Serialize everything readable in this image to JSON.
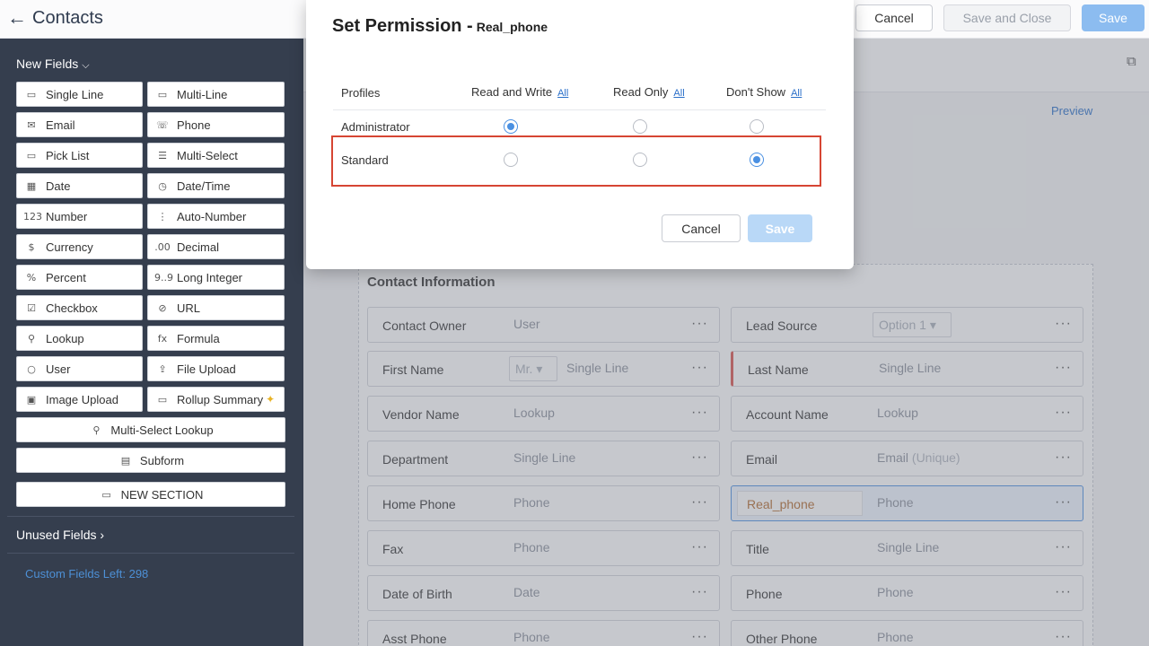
{
  "header": {
    "title": "Contacts",
    "cancel_label": "Cancel",
    "save_close_label": "Save and Close",
    "save_label": "Save"
  },
  "sidebar": {
    "new_fields_label": "New Fields",
    "fields": [
      {
        "label": "Single Line",
        "icon": "▭"
      },
      {
        "label": "Multi-Line",
        "icon": "▭"
      },
      {
        "label": "Email",
        "icon": "✉"
      },
      {
        "label": "Phone",
        "icon": "☏"
      },
      {
        "label": "Pick List",
        "icon": "▭"
      },
      {
        "label": "Multi-Select",
        "icon": "☰"
      },
      {
        "label": "Date",
        "icon": "▦"
      },
      {
        "label": "Date/Time",
        "icon": "◷"
      },
      {
        "label": "Number",
        "icon": "123"
      },
      {
        "label": "Auto-Number",
        "icon": "⋮"
      },
      {
        "label": "Currency",
        "icon": "$"
      },
      {
        "label": "Decimal",
        "icon": ".00"
      },
      {
        "label": "Percent",
        "icon": "%"
      },
      {
        "label": "Long Integer",
        "icon": "9..9"
      },
      {
        "label": "Checkbox",
        "icon": "☑"
      },
      {
        "label": "URL",
        "icon": "⊘"
      },
      {
        "label": "Lookup",
        "icon": "⚲"
      },
      {
        "label": "Formula",
        "icon": "fx"
      },
      {
        "label": "User",
        "icon": "○"
      },
      {
        "label": "File Upload",
        "icon": "⇪"
      },
      {
        "label": "Image Upload",
        "icon": "▣"
      },
      {
        "label": "Rollup Summary",
        "icon": "▭"
      }
    ],
    "multi_select_lookup": "Multi-Select Lookup",
    "subform": "Subform",
    "new_section": "NEW SECTION",
    "unused_fields_label": "Unused Fields",
    "custom_fields_left": "Custom Fields Left: 298"
  },
  "main": {
    "preview_label": "Preview",
    "section_title": "Contact Information",
    "fields": [
      {
        "label": "Contact Owner",
        "type": "User"
      },
      {
        "label": "Lead Source",
        "type": "Option 1"
      },
      {
        "label": "First Name",
        "prefix": "Mr.",
        "type": "Single Line"
      },
      {
        "label": "Last Name",
        "type": "Single Line"
      },
      {
        "label": "Vendor Name",
        "type": "Lookup"
      },
      {
        "label": "Account Name",
        "type": "Lookup"
      },
      {
        "label": "Department",
        "type": "Single Line"
      },
      {
        "label": "Email",
        "type": "Email",
        "suffix": "(Unique)"
      },
      {
        "label": "Home Phone",
        "type": "Phone"
      },
      {
        "label": "Real_phone",
        "type": "Phone"
      },
      {
        "label": "Fax",
        "type": "Phone"
      },
      {
        "label": "Title",
        "type": "Single Line"
      },
      {
        "label": "Date of Birth",
        "type": "Date"
      },
      {
        "label": "Phone",
        "type": "Phone"
      },
      {
        "label": "Asst Phone",
        "type": "Phone"
      },
      {
        "label": "Other Phone",
        "type": "Phone"
      }
    ]
  },
  "modal": {
    "title": "Set Permission -",
    "field_name": "Real_phone",
    "col_profiles": "Profiles",
    "col_read_write": "Read and Write",
    "col_read_only": "Read Only",
    "col_dont_show": "Don't Show",
    "all_label": "All",
    "rows": [
      {
        "profile": "Administrator",
        "selected": "read_write"
      },
      {
        "profile": "Standard",
        "selected": "dont_show"
      }
    ],
    "cancel_label": "Cancel",
    "save_label": "Save"
  }
}
